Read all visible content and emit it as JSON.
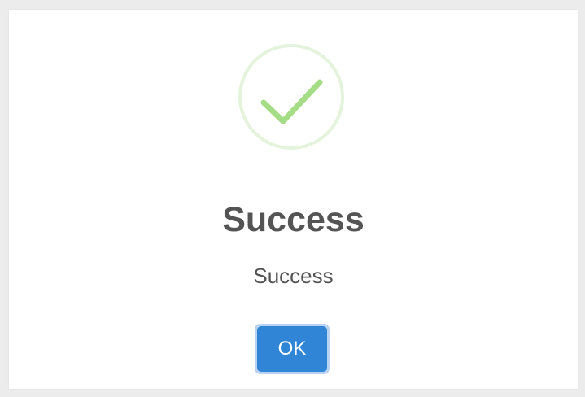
{
  "dialog": {
    "icon": "success-check-icon",
    "title": "Success",
    "message": "Success",
    "confirm_label": "OK"
  },
  "colors": {
    "icon_ring": "#e4f3dc",
    "icon_check": "#a5dc86",
    "text": "#545454",
    "button": "#3085d6",
    "button_focus_ring": "#b8d2f2"
  }
}
